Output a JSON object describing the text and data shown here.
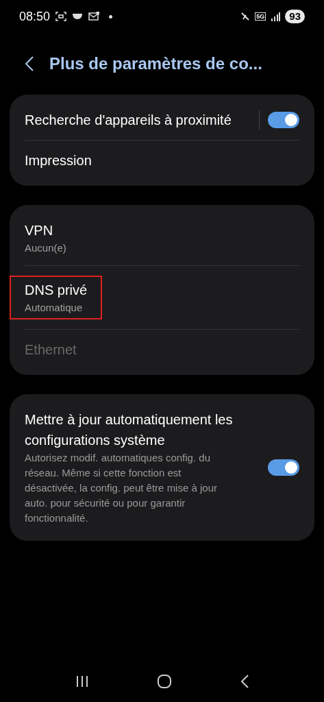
{
  "status_bar": {
    "time": "08:50",
    "network": "5G",
    "battery": "93"
  },
  "header": {
    "title": "Plus de paramètres de co..."
  },
  "groups": [
    {
      "items": [
        {
          "title": "Recherche d'appareils à proximité",
          "toggle": {
            "on": true
          },
          "disabled": false,
          "highlighted": false
        },
        {
          "title": "Impression",
          "disabled": false,
          "highlighted": false
        }
      ]
    },
    {
      "items": [
        {
          "title": "VPN",
          "subtitle": "Aucun(e)",
          "disabled": false,
          "highlighted": false
        },
        {
          "title": "DNS privé",
          "subtitle": "Automatique",
          "disabled": false,
          "highlighted": true
        },
        {
          "title": "Ethernet",
          "disabled": true,
          "highlighted": false
        }
      ]
    },
    {
      "items": [
        {
          "title": "Mettre à jour automatiquement les configurations système",
          "description": "Autorisez modif. automatiques config. du réseau. Même si cette fonction est désactivée, la config. peut être mise à jour auto. pour sécurité ou pour garantir fonctionnalité.",
          "toggle": {
            "on": true
          },
          "disabled": false,
          "highlighted": false
        }
      ]
    }
  ]
}
